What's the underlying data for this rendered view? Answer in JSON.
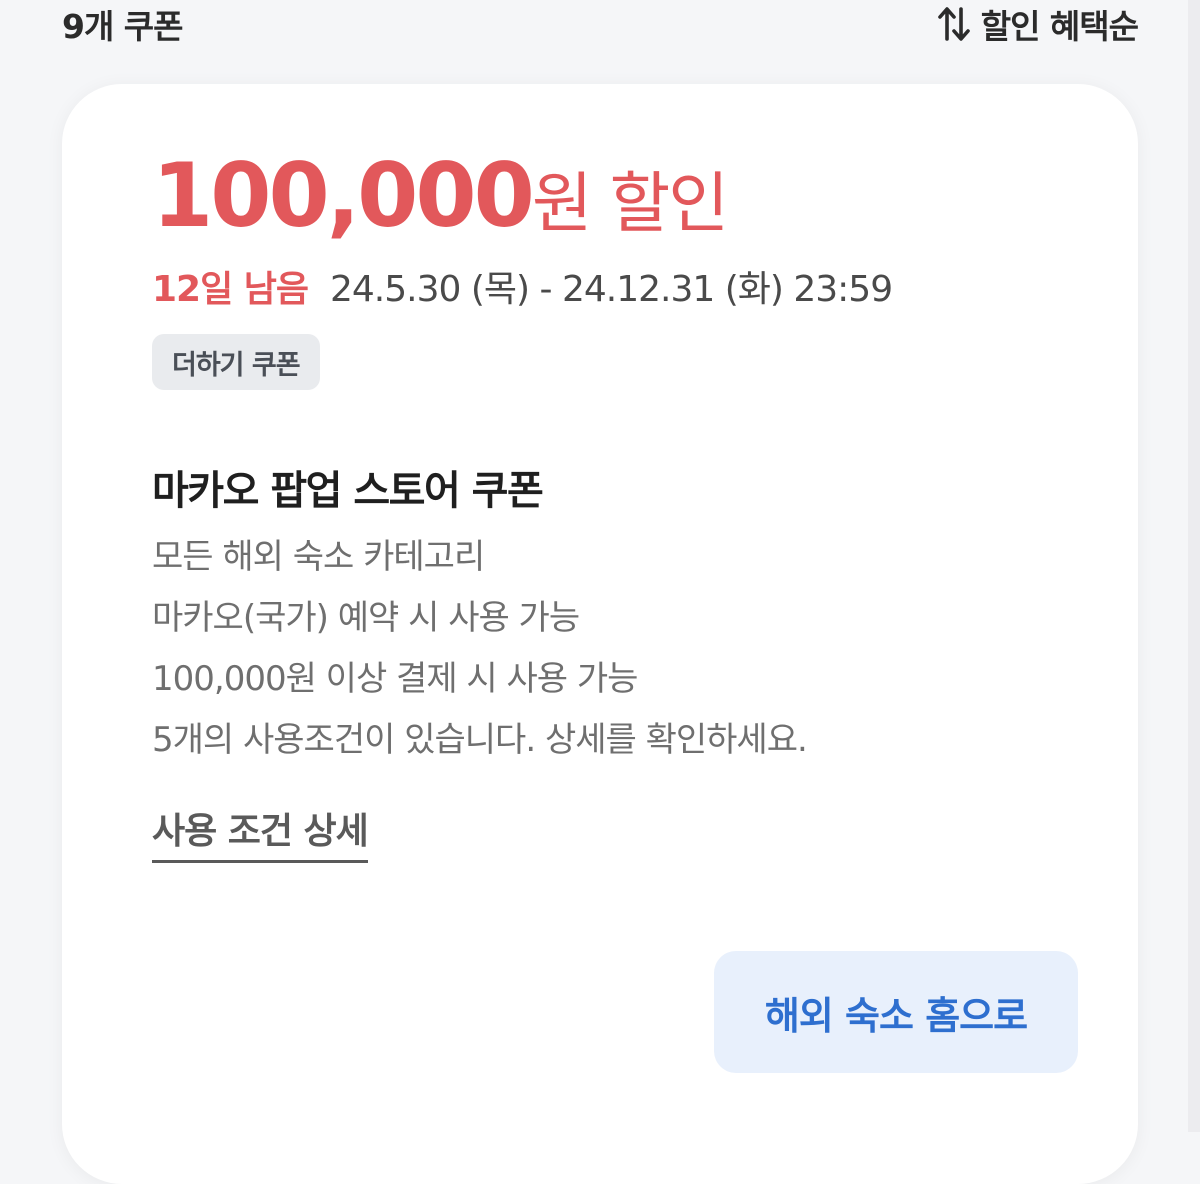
{
  "header": {
    "coupon_count": "9개 쿠폰",
    "sort_label": "할인 혜택순",
    "sort_icon": "sort-arrows-icon"
  },
  "coupon": {
    "amount": "100,000",
    "amount_suffix": "원 할인",
    "remaining": "12일 남음",
    "period": "24.5.30 (목) - 24.12.31 (화) 23:59",
    "tag": "더하기 쿠폰",
    "title": "마카오 팝업 스토어 쿠폰",
    "conditions": [
      "모든 해외 숙소 카테고리",
      "마카오(국가) 예약 시 사용 가능",
      "100,000원 이상 결제 시 사용 가능",
      "5개의 사용조건이 있습니다. 상세를 확인하세요."
    ],
    "detail_link": "사용 조건 상세",
    "action_button": "해외 숙소 홈으로"
  },
  "colors": {
    "accent_red": "#e2585b",
    "button_blue": "#2e6fcf",
    "button_bg": "#e8f0fc",
    "tag_bg": "#e9ebee"
  }
}
